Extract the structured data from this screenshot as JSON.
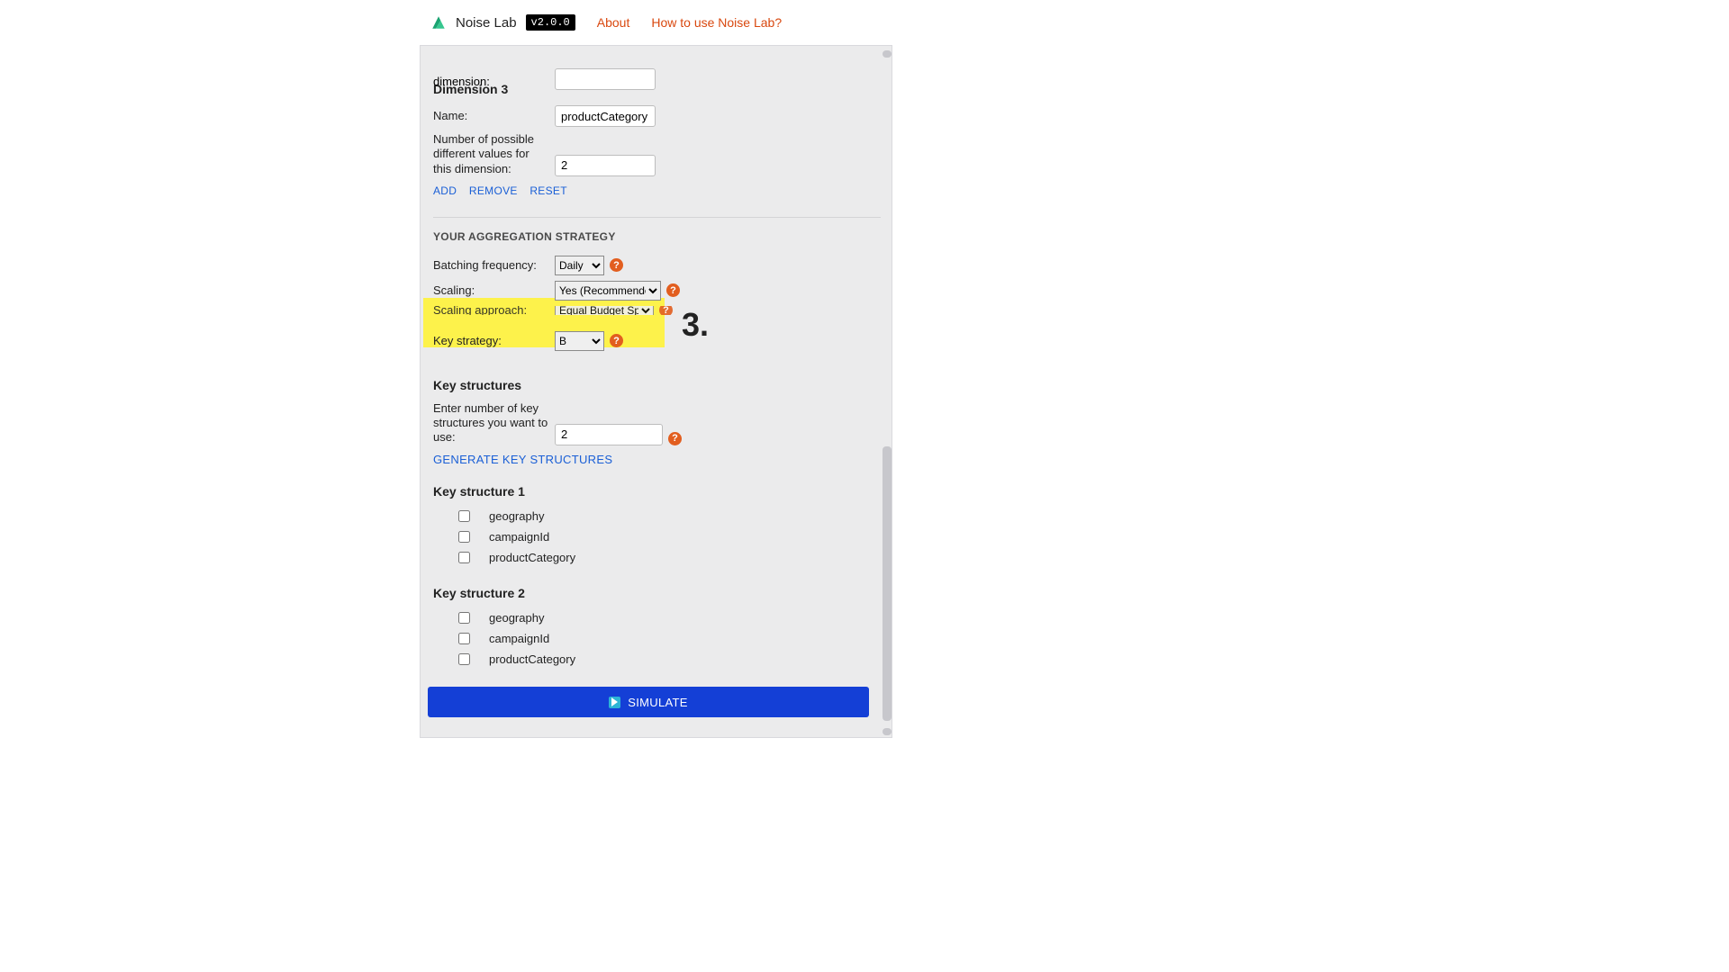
{
  "header": {
    "title": "Noise Lab",
    "version": "v2.0.0",
    "nav": {
      "about": "About",
      "howto": "How to use Noise Lab?"
    }
  },
  "form": {
    "dimension_top_label": "dimension:",
    "dim3": {
      "heading": "Dimension 3",
      "name_label": "Name:",
      "name_value": "productCategory",
      "count_label": "Number of possible different values for this dimension:",
      "count_value": "2"
    },
    "dim_actions": {
      "add": "ADD",
      "remove": "REMOVE",
      "reset": "RESET"
    },
    "agg": {
      "section": "YOUR AGGREGATION STRATEGY",
      "batch_label": "Batching frequency:",
      "batch_value": "Daily",
      "scaling_label": "Scaling:",
      "scaling_value": "Yes (Recommended)",
      "scaling_approach_label": "Scaling approach:",
      "scaling_approach_value": "Equal Budget Split",
      "key_strategy_label": "Key strategy:",
      "key_strategy_value": "B"
    },
    "ks": {
      "heading": "Key structures",
      "enter_label": "Enter number of key structures you want to use:",
      "enter_value": "2",
      "generate": "GENERATE KEY STRUCTURES",
      "s1": {
        "title": "Key structure 1",
        "items": [
          "geography",
          "campaignId",
          "productCategory"
        ]
      },
      "s2": {
        "title": "Key structure 2",
        "items": [
          "geography",
          "campaignId",
          "productCategory"
        ]
      }
    },
    "simulate": "SIMULATE"
  },
  "annotation": {
    "step3": "3."
  }
}
